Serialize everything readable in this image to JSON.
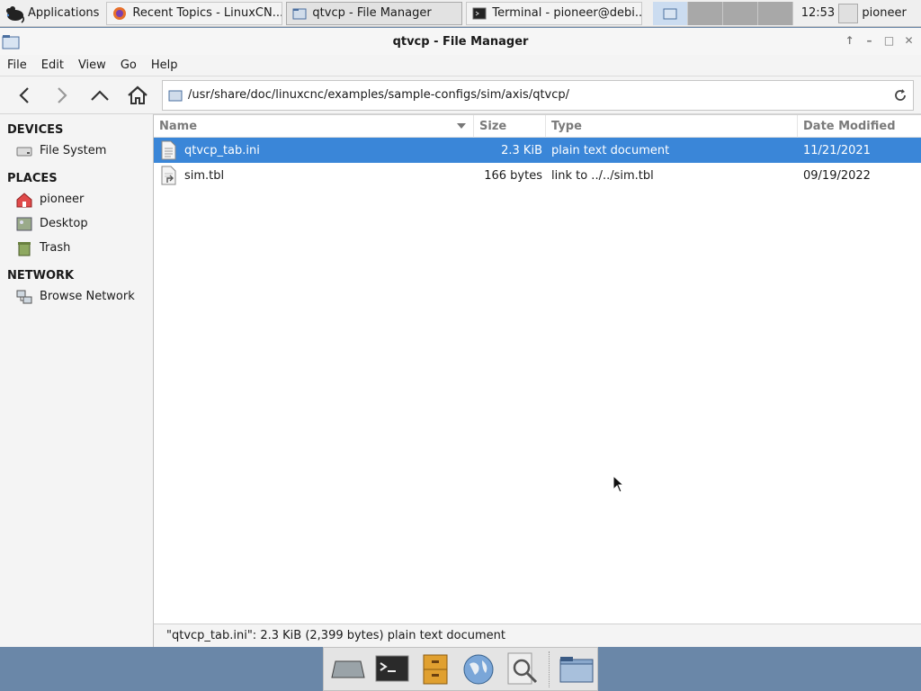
{
  "panel": {
    "apps_label": "Applications",
    "tasks": [
      {
        "label": "Recent Topics - LinuxCN..."
      },
      {
        "label": "qtvcp - File Manager"
      },
      {
        "label": "Terminal - pioneer@debi..."
      }
    ],
    "clock": "12:53",
    "user": "pioneer"
  },
  "window": {
    "title": "qtvcp - File Manager",
    "menu": [
      "File",
      "Edit",
      "View",
      "Go",
      "Help"
    ],
    "address": "/usr/share/doc/linuxcnc/examples/sample-configs/sim/axis/qtvcp/"
  },
  "sidebar": {
    "devices_title": "DEVICES",
    "devices": [
      {
        "label": "File System",
        "icon": "drive-icon"
      }
    ],
    "places_title": "PLACES",
    "places": [
      {
        "label": "pioneer",
        "icon": "home-icon"
      },
      {
        "label": "Desktop",
        "icon": "desktop-icon"
      },
      {
        "label": "Trash",
        "icon": "trash-icon"
      }
    ],
    "network_title": "NETWORK",
    "network": [
      {
        "label": "Browse Network",
        "icon": "network-icon"
      }
    ]
  },
  "list": {
    "columns": {
      "name": "Name",
      "size": "Size",
      "type": "Type",
      "date": "Date Modified"
    },
    "rows": [
      {
        "name": "qtvcp_tab.ini",
        "size": "2.3 KiB",
        "type": "plain text document",
        "date": "11/21/2021",
        "selected": true
      },
      {
        "name": "sim.tbl",
        "size": "166 bytes",
        "type": "link to ../../sim.tbl",
        "date": "09/19/2022",
        "selected": false
      }
    ]
  },
  "status": "\"qtvcp_tab.ini\": 2.3 KiB (2,399 bytes) plain text document",
  "colors": {
    "selection": "#3a86d8",
    "desktop": "#6a87a8"
  }
}
